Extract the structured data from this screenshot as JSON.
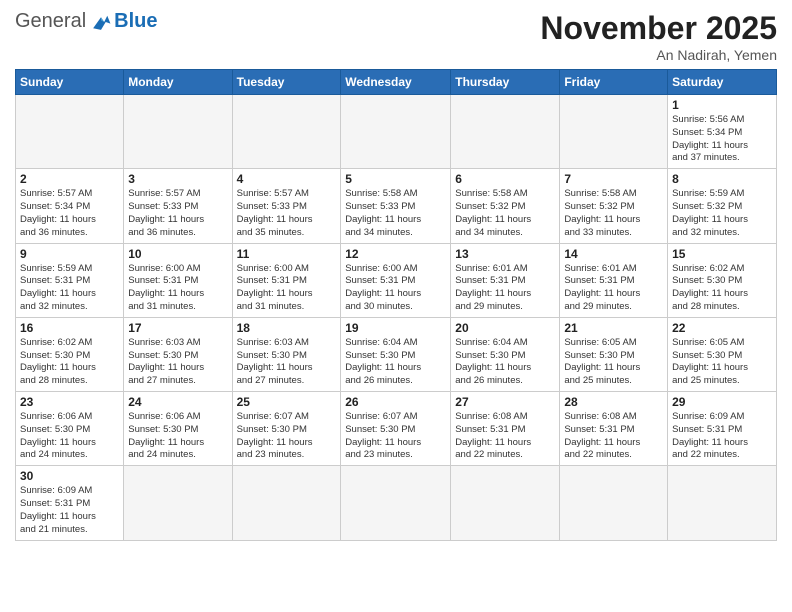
{
  "header": {
    "logo_general": "General",
    "logo_blue": "Blue",
    "month_year": "November 2025",
    "location": "An Nadirah, Yemen"
  },
  "weekdays": [
    "Sunday",
    "Monday",
    "Tuesday",
    "Wednesday",
    "Thursday",
    "Friday",
    "Saturday"
  ],
  "weeks": [
    [
      {
        "day": "",
        "info": ""
      },
      {
        "day": "",
        "info": ""
      },
      {
        "day": "",
        "info": ""
      },
      {
        "day": "",
        "info": ""
      },
      {
        "day": "",
        "info": ""
      },
      {
        "day": "",
        "info": ""
      },
      {
        "day": "1",
        "info": "Sunrise: 5:56 AM\nSunset: 5:34 PM\nDaylight: 11 hours\nand 37 minutes."
      }
    ],
    [
      {
        "day": "2",
        "info": "Sunrise: 5:57 AM\nSunset: 5:34 PM\nDaylight: 11 hours\nand 36 minutes."
      },
      {
        "day": "3",
        "info": "Sunrise: 5:57 AM\nSunset: 5:33 PM\nDaylight: 11 hours\nand 36 minutes."
      },
      {
        "day": "4",
        "info": "Sunrise: 5:57 AM\nSunset: 5:33 PM\nDaylight: 11 hours\nand 35 minutes."
      },
      {
        "day": "5",
        "info": "Sunrise: 5:58 AM\nSunset: 5:33 PM\nDaylight: 11 hours\nand 34 minutes."
      },
      {
        "day": "6",
        "info": "Sunrise: 5:58 AM\nSunset: 5:32 PM\nDaylight: 11 hours\nand 34 minutes."
      },
      {
        "day": "7",
        "info": "Sunrise: 5:58 AM\nSunset: 5:32 PM\nDaylight: 11 hours\nand 33 minutes."
      },
      {
        "day": "8",
        "info": "Sunrise: 5:59 AM\nSunset: 5:32 PM\nDaylight: 11 hours\nand 32 minutes."
      }
    ],
    [
      {
        "day": "9",
        "info": "Sunrise: 5:59 AM\nSunset: 5:31 PM\nDaylight: 11 hours\nand 32 minutes."
      },
      {
        "day": "10",
        "info": "Sunrise: 6:00 AM\nSunset: 5:31 PM\nDaylight: 11 hours\nand 31 minutes."
      },
      {
        "day": "11",
        "info": "Sunrise: 6:00 AM\nSunset: 5:31 PM\nDaylight: 11 hours\nand 31 minutes."
      },
      {
        "day": "12",
        "info": "Sunrise: 6:00 AM\nSunset: 5:31 PM\nDaylight: 11 hours\nand 30 minutes."
      },
      {
        "day": "13",
        "info": "Sunrise: 6:01 AM\nSunset: 5:31 PM\nDaylight: 11 hours\nand 29 minutes."
      },
      {
        "day": "14",
        "info": "Sunrise: 6:01 AM\nSunset: 5:31 PM\nDaylight: 11 hours\nand 29 minutes."
      },
      {
        "day": "15",
        "info": "Sunrise: 6:02 AM\nSunset: 5:30 PM\nDaylight: 11 hours\nand 28 minutes."
      }
    ],
    [
      {
        "day": "16",
        "info": "Sunrise: 6:02 AM\nSunset: 5:30 PM\nDaylight: 11 hours\nand 28 minutes."
      },
      {
        "day": "17",
        "info": "Sunrise: 6:03 AM\nSunset: 5:30 PM\nDaylight: 11 hours\nand 27 minutes."
      },
      {
        "day": "18",
        "info": "Sunrise: 6:03 AM\nSunset: 5:30 PM\nDaylight: 11 hours\nand 27 minutes."
      },
      {
        "day": "19",
        "info": "Sunrise: 6:04 AM\nSunset: 5:30 PM\nDaylight: 11 hours\nand 26 minutes."
      },
      {
        "day": "20",
        "info": "Sunrise: 6:04 AM\nSunset: 5:30 PM\nDaylight: 11 hours\nand 26 minutes."
      },
      {
        "day": "21",
        "info": "Sunrise: 6:05 AM\nSunset: 5:30 PM\nDaylight: 11 hours\nand 25 minutes."
      },
      {
        "day": "22",
        "info": "Sunrise: 6:05 AM\nSunset: 5:30 PM\nDaylight: 11 hours\nand 25 minutes."
      }
    ],
    [
      {
        "day": "23",
        "info": "Sunrise: 6:06 AM\nSunset: 5:30 PM\nDaylight: 11 hours\nand 24 minutes."
      },
      {
        "day": "24",
        "info": "Sunrise: 6:06 AM\nSunset: 5:30 PM\nDaylight: 11 hours\nand 24 minutes."
      },
      {
        "day": "25",
        "info": "Sunrise: 6:07 AM\nSunset: 5:30 PM\nDaylight: 11 hours\nand 23 minutes."
      },
      {
        "day": "26",
        "info": "Sunrise: 6:07 AM\nSunset: 5:30 PM\nDaylight: 11 hours\nand 23 minutes."
      },
      {
        "day": "27",
        "info": "Sunrise: 6:08 AM\nSunset: 5:31 PM\nDaylight: 11 hours\nand 22 minutes."
      },
      {
        "day": "28",
        "info": "Sunrise: 6:08 AM\nSunset: 5:31 PM\nDaylight: 11 hours\nand 22 minutes."
      },
      {
        "day": "29",
        "info": "Sunrise: 6:09 AM\nSunset: 5:31 PM\nDaylight: 11 hours\nand 22 minutes."
      }
    ],
    [
      {
        "day": "30",
        "info": "Sunrise: 6:09 AM\nSunset: 5:31 PM\nDaylight: 11 hours\nand 21 minutes."
      },
      {
        "day": "",
        "info": ""
      },
      {
        "day": "",
        "info": ""
      },
      {
        "day": "",
        "info": ""
      },
      {
        "day": "",
        "info": ""
      },
      {
        "day": "",
        "info": ""
      },
      {
        "day": "",
        "info": ""
      }
    ]
  ]
}
